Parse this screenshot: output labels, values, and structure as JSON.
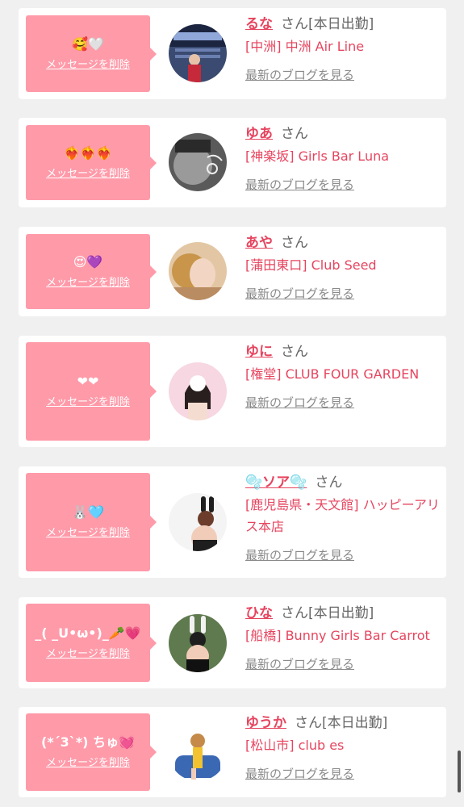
{
  "delete_label": "メッセージを削除",
  "blog_label": "最新のブログを見る",
  "san_label": "さん",
  "accent_color": "#ff9aa9",
  "name_color": "#e6455f",
  "entries": [
    {
      "message": "🥰🤍",
      "name": "るな",
      "status": "[本日出勤]",
      "shop": "[中洲] 中洲 Air Line",
      "avatar_icon": "photo-avatar-airline"
    },
    {
      "message": "❤️‍🔥❤️‍🔥❤️‍🔥",
      "name": "ゆあ",
      "status": "",
      "shop": "[神楽坂] Girls Bar Luna",
      "avatar_icon": "photo-avatar-mono"
    },
    {
      "message": "😍💜",
      "name": "あや",
      "status": "",
      "shop": "[蒲田東口] Club Seed",
      "avatar_icon": "photo-avatar-blonde"
    },
    {
      "message": "❤❤",
      "name": "ゆに",
      "status": "",
      "shop": "[権堂] CLUB FOUR GARDEN",
      "avatar_icon": "photo-avatar-pink"
    },
    {
      "message": "🐰🩵",
      "name": "🫧ソア🫧",
      "status": "",
      "shop": "[鹿児島県・天文館] ハッピーアリス本店",
      "avatar_icon": "photo-avatar-bunny-white"
    },
    {
      "message": "_( _U•ω•)_🥕💗",
      "name": "ひな",
      "status": "[本日出勤]",
      "shop": "[船橋] Bunny Girls Bar Carrot",
      "avatar_icon": "photo-avatar-bunny-black"
    },
    {
      "message": "(*´3`*) ちゅ💓",
      "name": "ゆうか",
      "status": "[本日出勤]",
      "shop": "[松山市] club es",
      "avatar_icon": "photo-avatar-chair"
    }
  ]
}
